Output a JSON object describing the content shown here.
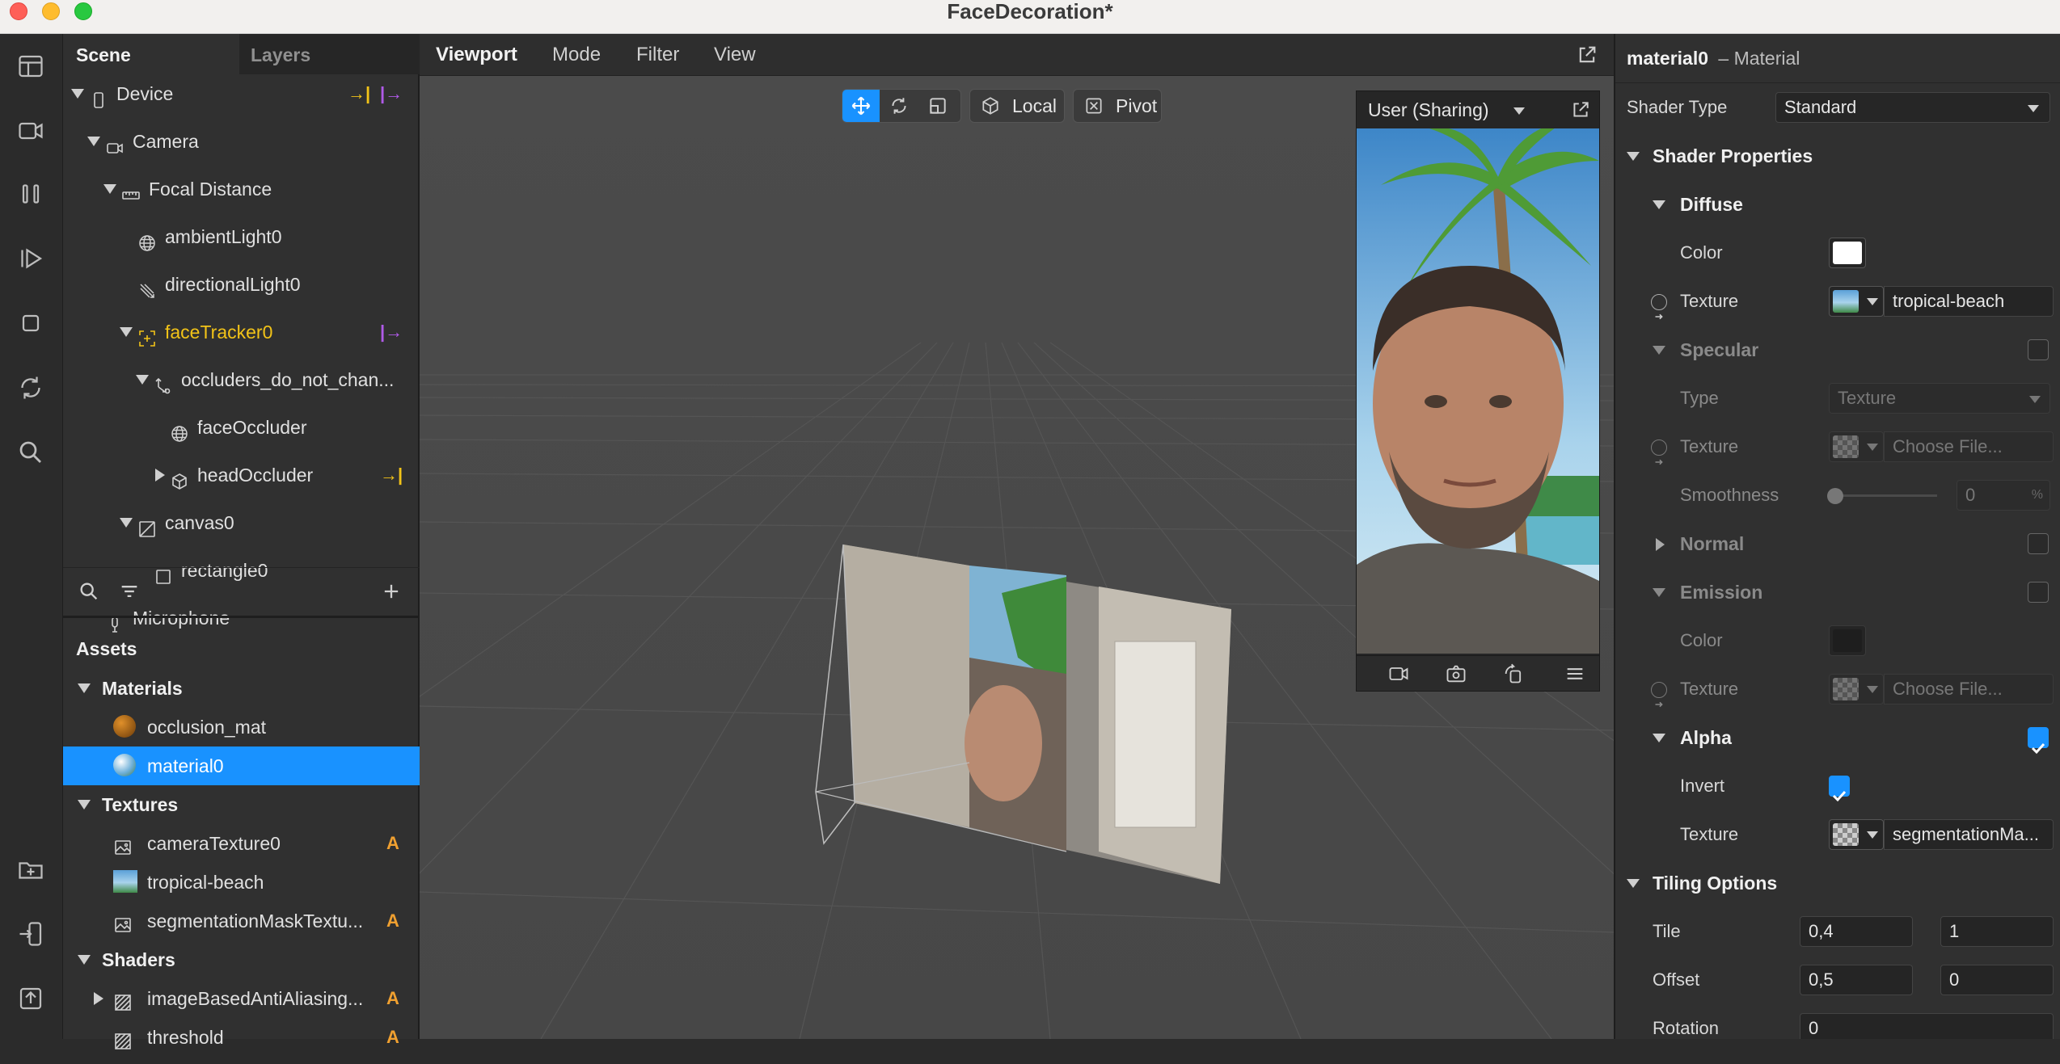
{
  "window": {
    "title": "FaceDecoration*"
  },
  "scene_panel": {
    "tabs": [
      "Scene",
      "Layers"
    ],
    "tree": [
      {
        "label": "Device",
        "icon": "phone-icon",
        "depth": 0,
        "caret": "down"
      },
      {
        "label": "Camera",
        "icon": "camera-icon",
        "depth": 1,
        "caret": "down"
      },
      {
        "label": "Focal Distance",
        "icon": "ruler-icon",
        "depth": 2,
        "caret": "down"
      },
      {
        "label": "ambientLight0",
        "icon": "globe-icon",
        "depth": 3,
        "caret": "none"
      },
      {
        "label": "directionalLight0",
        "icon": "directional-light-icon",
        "depth": 3,
        "caret": "none"
      },
      {
        "label": "faceTracker0",
        "icon": "face-tracker-icon",
        "depth": 3,
        "caret": "down",
        "highlight": true
      },
      {
        "label": "occluders_do_not_chan...",
        "icon": "null-object-icon",
        "depth": 4,
        "caret": "down"
      },
      {
        "label": "faceOccluder",
        "icon": "globe-icon",
        "depth": 5,
        "caret": "none"
      },
      {
        "label": "headOccluder",
        "icon": "cube-icon",
        "depth": 5,
        "caret": "right"
      },
      {
        "label": "canvas0",
        "icon": "canvas-icon",
        "depth": 3,
        "caret": "down"
      },
      {
        "label": "rectangle0",
        "icon": "rectangle-icon",
        "depth": 4,
        "caret": "none"
      },
      {
        "label": "Microphone",
        "icon": "microphone-icon",
        "depth": 1,
        "caret": "none"
      }
    ]
  },
  "assets_panel": {
    "title": "Assets",
    "materials_label": "Materials",
    "materials": [
      "occlusion_mat",
      "material0"
    ],
    "textures_label": "Textures",
    "textures": [
      {
        "label": "cameraTexture0",
        "badge": "A"
      },
      {
        "label": "tropical-beach",
        "badge": ""
      },
      {
        "label": "segmentationMaskTextu...",
        "badge": "A"
      }
    ],
    "shaders_label": "Shaders",
    "shaders": [
      {
        "label": "imageBasedAntiAliasing...",
        "badge": "A"
      },
      {
        "label": "threshold",
        "badge": "A"
      }
    ]
  },
  "viewport": {
    "tabs": [
      "Viewport",
      "Mode",
      "Filter",
      "View"
    ],
    "local_label": "Local",
    "pivot_label": "Pivot",
    "simulator_device": "User (Sharing)"
  },
  "properties": {
    "title": "material0",
    "subtitle": "– Material",
    "shader_type_label": "Shader Type",
    "shader_type_value": "Standard",
    "shader_properties_label": "Shader Properties",
    "diffuse": {
      "label": "Diffuse",
      "color_label": "Color",
      "texture_label": "Texture",
      "texture_value": "tropical-beach",
      "color": "#ffffff"
    },
    "specular": {
      "label": "Specular",
      "type_label": "Type",
      "type_value": "Texture",
      "texture_label": "Texture",
      "texture_value": "Choose File...",
      "smoothness_label": "Smoothness",
      "smoothness_value": "0",
      "smoothness_unit": "%"
    },
    "normal": {
      "label": "Normal"
    },
    "emission": {
      "label": "Emission",
      "color_label": "Color",
      "texture_label": "Texture",
      "texture_value": "Choose File...",
      "color": "#1e1e1e"
    },
    "alpha": {
      "label": "Alpha",
      "invert_label": "Invert",
      "texture_label": "Texture",
      "texture_value": "segmentationMa..."
    },
    "tiling": {
      "label": "Tiling Options",
      "tile_label": "Tile",
      "tile_x": "0,4",
      "tile_y": "1",
      "offset_label": "Offset",
      "offset_x": "0,5",
      "offset_y": "0",
      "rotation_label": "Rotation",
      "rotation_value": "0"
    }
  },
  "colors": {
    "accent": "#1992ff",
    "highlight_yellow": "#f2c318",
    "badge_orange": "#f0a030",
    "purple": "#b05ae8"
  }
}
